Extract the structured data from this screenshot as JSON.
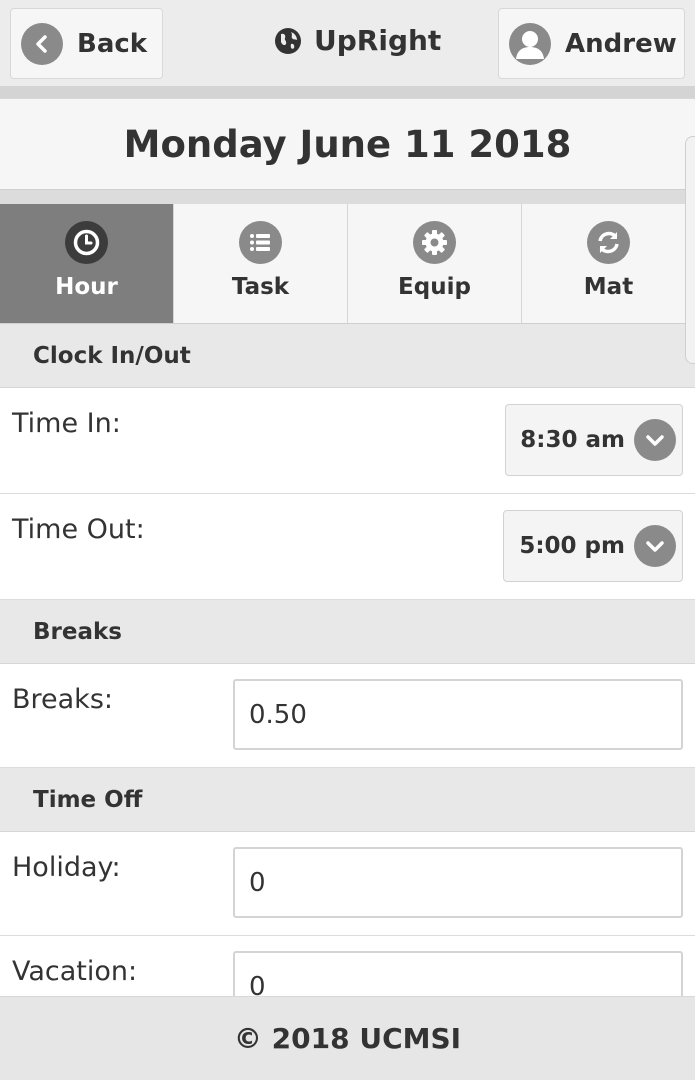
{
  "header": {
    "back_label": "Back",
    "brand": "UpRight",
    "user_name": "Andrew"
  },
  "date_title": "Monday June 11 2018",
  "tabs": [
    {
      "label": "Hour",
      "icon": "clock-icon",
      "active": true
    },
    {
      "label": "Task",
      "icon": "list-icon",
      "active": false
    },
    {
      "label": "Equip",
      "icon": "gear-icon",
      "active": false
    },
    {
      "label": "Mat",
      "icon": "refresh-icon",
      "active": false
    }
  ],
  "sections": {
    "clock": {
      "title": "Clock In/Out",
      "time_in_label": "Time In:",
      "time_in_value": "8:30 am",
      "time_out_label": "Time Out:",
      "time_out_value": "5:00 pm"
    },
    "breaks": {
      "title": "Breaks",
      "breaks_label": "Breaks:",
      "breaks_value": "0.50"
    },
    "time_off": {
      "title": "Time Off",
      "holiday_label": "Holiday:",
      "holiday_value": "0",
      "vacation_label": "Vacation:",
      "vacation_value": "0"
    }
  },
  "footer": "© 2018 UCMSI",
  "colors": {
    "active_tab": "#7e7e7e",
    "icon_circle": "#8a8a8a",
    "background": "#ececec"
  }
}
